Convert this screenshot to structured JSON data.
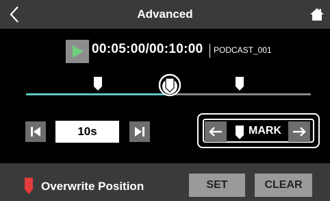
{
  "header": {
    "title": "Advanced",
    "back_icon": "chevron-left-icon",
    "home_icon": "home-icon"
  },
  "transport": {
    "play_icon": "play-icon",
    "time_display": "00:05:00/00:10:00",
    "project_name": "PODCAST_001",
    "playhead_position_fraction": 0.5
  },
  "markers": {
    "positions_fraction": [
      0.25,
      0.5,
      0.75
    ]
  },
  "skip": {
    "prev_icon": "skip-back-icon",
    "value": "10s",
    "next_icon": "skip-forward-icon"
  },
  "mark_nav": {
    "prev_icon": "arrow-left-icon",
    "marker_icon": "marker-icon",
    "label": "MARK",
    "next_icon": "arrow-right-icon"
  },
  "footer": {
    "flag_icon": "marker-red-icon",
    "label": "Overwrite Position",
    "set_label": "SET",
    "clear_label": "CLEAR"
  },
  "colors": {
    "accent": "#5fc6c2",
    "play_green": "#6fcf7a",
    "marker_red": "#e23b3b",
    "bar_gray": "#3a3a3a"
  }
}
